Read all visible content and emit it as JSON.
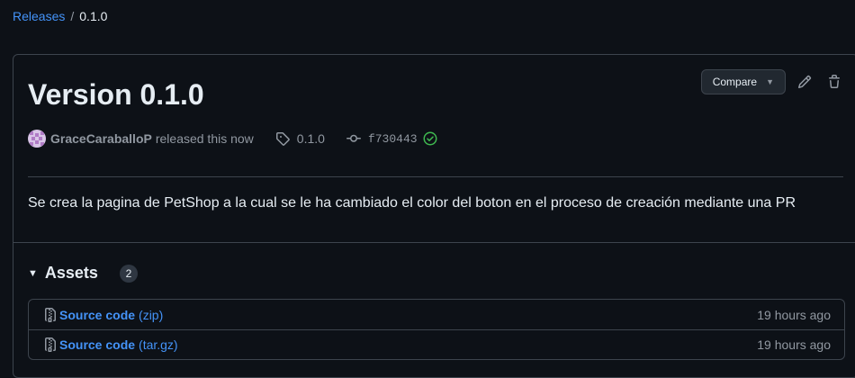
{
  "breadcrumb": {
    "parent": "Releases",
    "separator": "/",
    "current": "0.1.0"
  },
  "release": {
    "title": "Version 0.1.0",
    "author": "GraceCaraballoP",
    "action_text": "released this now",
    "tag": "0.1.0",
    "commit": "f730443",
    "description": "Se crea la pagina de PetShop a la cual se le ha cambiado el color del boton en el proceso de creación mediante una PR"
  },
  "actions": {
    "compare_label": "Compare",
    "icons": [
      "pencil-icon",
      "trash-icon"
    ]
  },
  "assets": {
    "title": "Assets",
    "count": "2",
    "items": [
      {
        "name": "Source code",
        "ext": "(zip)",
        "time": "19 hours ago"
      },
      {
        "name": "Source code",
        "ext": "(tar.gz)",
        "time": "19 hours ago"
      }
    ]
  },
  "colors": {
    "background": "#0d1117",
    "border": "#3d444d",
    "link": "#4493f8",
    "muted": "#9198a1",
    "success": "#3fb950"
  }
}
